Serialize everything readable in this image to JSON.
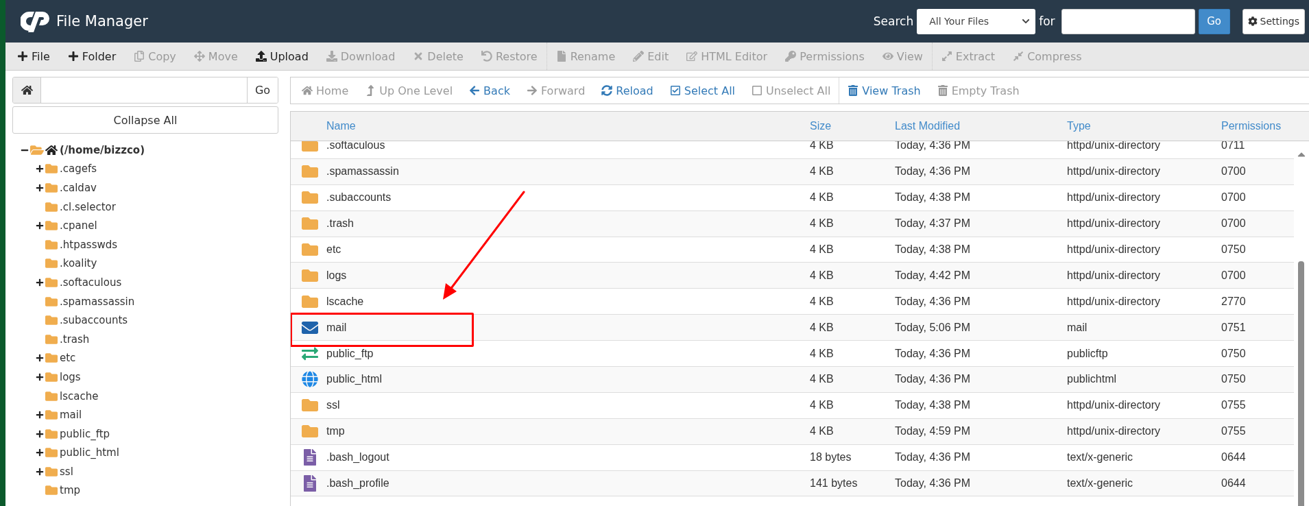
{
  "header": {
    "title": "File Manager",
    "search_label": "Search",
    "search_scope": "All Your Files",
    "for_label": "for",
    "go": "Go",
    "settings": "Settings"
  },
  "toolbar": {
    "groups": [
      {
        "items": [
          {
            "label": "File",
            "disabled": false
          },
          {
            "label": "Folder",
            "disabled": false
          },
          {
            "label": "Copy",
            "disabled": true
          },
          {
            "label": "Move",
            "disabled": true
          },
          {
            "label": "Upload",
            "disabled": false
          },
          {
            "label": "Download",
            "disabled": true
          },
          {
            "label": "Delete",
            "disabled": true
          },
          {
            "label": "Restore",
            "disabled": true
          }
        ]
      },
      {
        "items": [
          {
            "label": "Rename",
            "disabled": true
          },
          {
            "label": "Edit",
            "disabled": true
          },
          {
            "label": "HTML Editor",
            "disabled": true
          },
          {
            "label": "Permissions",
            "disabled": true
          },
          {
            "label": "View",
            "disabled": true
          }
        ]
      },
      {
        "items": [
          {
            "label": "Extract",
            "disabled": true
          },
          {
            "label": "Compress",
            "disabled": true
          }
        ]
      }
    ]
  },
  "sidebar": {
    "go": "Go",
    "collapse_all": "Collapse All",
    "tree": [
      {
        "label": "(/home/bizzco)",
        "expanded": true,
        "children": [
          {
            "label": ".cagefs",
            "expandable": true
          },
          {
            "label": ".caldav",
            "expandable": true
          },
          {
            "label": ".cl.selector",
            "expandable": false
          },
          {
            "label": ".cpanel",
            "expandable": true
          },
          {
            "label": ".htpasswds",
            "expandable": false
          },
          {
            "label": ".koality",
            "expandable": false
          },
          {
            "label": ".softaculous",
            "expandable": true
          },
          {
            "label": ".spamassassin",
            "expandable": false
          },
          {
            "label": ".subaccounts",
            "expandable": false
          },
          {
            "label": ".trash",
            "expandable": false
          },
          {
            "label": "etc",
            "expandable": true
          },
          {
            "label": "logs",
            "expandable": true
          },
          {
            "label": "lscache",
            "expandable": false
          },
          {
            "label": "mail",
            "expandable": true
          },
          {
            "label": "public_ftp",
            "expandable": true
          },
          {
            "label": "public_html",
            "expandable": true
          },
          {
            "label": "ssl",
            "expandable": true
          },
          {
            "label": "tmp",
            "expandable": false
          }
        ]
      }
    ]
  },
  "navbar": {
    "groups": [
      {
        "items": [
          {
            "label": "Home",
            "disabled": true
          },
          {
            "label": "Up One Level",
            "disabled": true
          },
          {
            "label": "Back",
            "disabled": false
          },
          {
            "label": "Forward",
            "disabled": true
          },
          {
            "label": "Reload",
            "disabled": false
          },
          {
            "label": "Select All",
            "disabled": false
          },
          {
            "label": "Unselect All",
            "disabled": true
          }
        ]
      },
      {
        "items": [
          {
            "label": "View Trash",
            "disabled": false
          },
          {
            "label": "Empty Trash",
            "disabled": true
          }
        ]
      }
    ]
  },
  "table": {
    "columns": [
      "Name",
      "Size",
      "Last Modified",
      "Type",
      "Permissions"
    ],
    "rows": [
      {
        "kind": "folder",
        "name": ".softaculous",
        "size": "4 KB",
        "modified": "Today, 4:36 PM",
        "type": "httpd/unix-directory",
        "permissions": "0711",
        "highlighted": false
      },
      {
        "kind": "folder",
        "name": ".spamassassin",
        "size": "4 KB",
        "modified": "Today, 4:36 PM",
        "type": "httpd/unix-directory",
        "permissions": "0700",
        "highlighted": false
      },
      {
        "kind": "folder",
        "name": ".subaccounts",
        "size": "4 KB",
        "modified": "Today, 4:38 PM",
        "type": "httpd/unix-directory",
        "permissions": "0700",
        "highlighted": false
      },
      {
        "kind": "folder",
        "name": ".trash",
        "size": "4 KB",
        "modified": "Today, 4:37 PM",
        "type": "httpd/unix-directory",
        "permissions": "0700",
        "highlighted": false
      },
      {
        "kind": "folder",
        "name": "etc",
        "size": "4 KB",
        "modified": "Today, 4:38 PM",
        "type": "httpd/unix-directory",
        "permissions": "0750",
        "highlighted": false
      },
      {
        "kind": "folder",
        "name": "logs",
        "size": "4 KB",
        "modified": "Today, 4:42 PM",
        "type": "httpd/unix-directory",
        "permissions": "0700",
        "highlighted": false
      },
      {
        "kind": "folder",
        "name": "lscache",
        "size": "4 KB",
        "modified": "Today, 4:36 PM",
        "type": "httpd/unix-directory",
        "permissions": "2770",
        "highlighted": false
      },
      {
        "kind": "mail",
        "name": "mail",
        "size": "4 KB",
        "modified": "Today, 5:06 PM",
        "type": "mail",
        "permissions": "0751",
        "highlighted": true
      },
      {
        "kind": "ftp",
        "name": "public_ftp",
        "size": "4 KB",
        "modified": "Today, 4:36 PM",
        "type": "publicftp",
        "permissions": "0750",
        "highlighted": false
      },
      {
        "kind": "web",
        "name": "public_html",
        "size": "4 KB",
        "modified": "Today, 4:36 PM",
        "type": "publichtml",
        "permissions": "0750",
        "highlighted": false
      },
      {
        "kind": "folder",
        "name": "ssl",
        "size": "4 KB",
        "modified": "Today, 4:38 PM",
        "type": "httpd/unix-directory",
        "permissions": "0755",
        "highlighted": false
      },
      {
        "kind": "folder",
        "name": "tmp",
        "size": "4 KB",
        "modified": "Today, 4:59 PM",
        "type": "httpd/unix-directory",
        "permissions": "0755",
        "highlighted": false
      },
      {
        "kind": "file",
        "name": ".bash_logout",
        "size": "18 bytes",
        "modified": "Today, 4:36 PM",
        "type": "text/x-generic",
        "permissions": "0644",
        "highlighted": false
      },
      {
        "kind": "file",
        "name": ".bash_profile",
        "size": "141 bytes",
        "modified": "Today, 4:36 PM",
        "type": "text/x-generic",
        "permissions": "0644",
        "highlighted": false
      }
    ]
  }
}
